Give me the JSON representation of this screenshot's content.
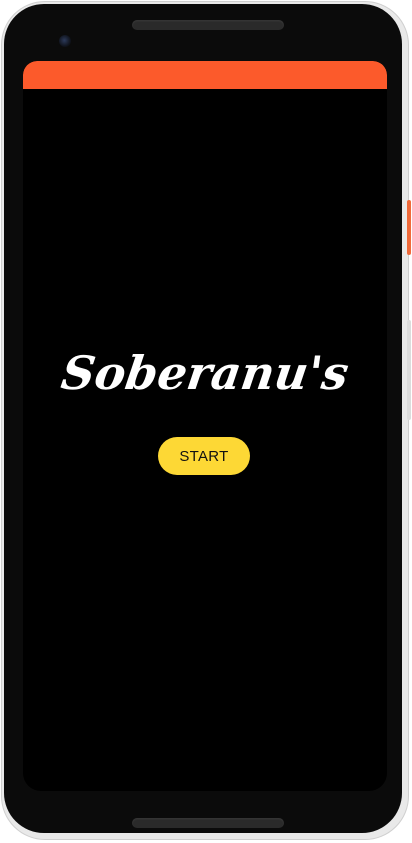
{
  "app": {
    "logo_text": "Soberanu's",
    "start_label": "START"
  },
  "colors": {
    "app_bar": "#fc5a2b",
    "screen_background": "#000000",
    "start_button": "#fdd835",
    "logo_text": "#ffffff"
  },
  "icons": {
    "camera": "front-camera-icon",
    "speaker": "speaker-grille-icon"
  }
}
